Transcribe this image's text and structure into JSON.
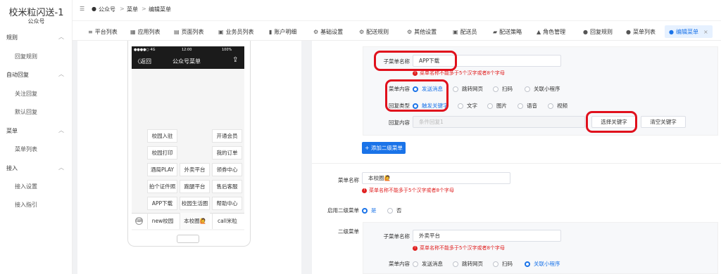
{
  "app": {
    "title": "校米粒闪送-1",
    "subtitle": "公众号"
  },
  "sidebar": {
    "groups": [
      {
        "label": "规则",
        "items": [
          "回复规则"
        ]
      },
      {
        "label": "自动回复",
        "items": [
          "关注回复",
          "默认回复"
        ]
      },
      {
        "label": "菜单",
        "items": [
          "菜单列表"
        ]
      },
      {
        "label": "接入",
        "items": [
          "接入设置",
          "接入指引"
        ]
      }
    ]
  },
  "breadcrumb": {
    "items": [
      "公众号",
      "菜单",
      "编辑菜单"
    ],
    "sep": ">"
  },
  "tabs": [
    {
      "label": "平台列表",
      "icon": "≡"
    },
    {
      "label": "应用列表",
      "icon": "▦"
    },
    {
      "label": "页面列表",
      "icon": "▤"
    },
    {
      "label": "业务员列表",
      "icon": "▣"
    },
    {
      "label": "账户明细",
      "icon": "▮"
    },
    {
      "label": "基础设置",
      "icon": "⚙"
    },
    {
      "label": "配送规则",
      "icon": "⚙"
    },
    {
      "label": "其他设置",
      "icon": "⚙"
    },
    {
      "label": "配送员",
      "icon": "▣"
    },
    {
      "label": "配送策略",
      "icon": "▰"
    },
    {
      "label": "角色管理",
      "icon": "▲"
    },
    {
      "label": "回复规则",
      "icon": "●"
    },
    {
      "label": "菜单列表",
      "icon": "●"
    },
    {
      "label": "编辑菜单",
      "icon": "●",
      "close": "×"
    }
  ],
  "phone": {
    "status_left": "●●●●○ 4G",
    "status_time": "12:00",
    "status_right": "100%",
    "back_label": "〈返回",
    "header_title": "公众号菜单",
    "share_icon": "⇪",
    "col1": [
      "校园入驻",
      "校园打印",
      "酒局PLAY",
      "拍个证件照",
      "APP下载"
    ],
    "col2": [
      "外卖平台",
      "跑腿平台",
      "校园生活圈"
    ],
    "col3": [
      "开通会员",
      "我的订单",
      "领券中心",
      "售后客服",
      "帮助中心"
    ],
    "bottom": [
      "new校园",
      "本校圈🙋",
      "call米粒"
    ]
  },
  "form": {
    "sub_name_label": "子菜单名称",
    "sub_name_value": "APP下载",
    "err_text": "菜单名称不能多于5个汉字或者8个字母",
    "content_label": "菜单内容",
    "content_opts": [
      "发送消息",
      "跳转网页",
      "扫码",
      "关联小程序"
    ],
    "reply_type_label": "回复类型",
    "reply_opts": [
      "触发关键字",
      "文字",
      "图片",
      "语音",
      "视频"
    ],
    "reply_content_label": "回复内容",
    "reply_content_ph": "条件回复1",
    "select_kw": "选择关键字",
    "clear_kw": "清空关键字",
    "add_sub": "+ 添加二级菜单",
    "menu_name_label": "菜单名称",
    "menu_name_value": "本校圈🙋",
    "enable_label": "启用二级菜单",
    "yes": "是",
    "no": "否",
    "second_label": "二级菜单",
    "sub2_name_value": "外卖平台",
    "content_opts2": [
      "发送消息",
      "跳转网页",
      "扫码",
      "关联小程序"
    ]
  }
}
